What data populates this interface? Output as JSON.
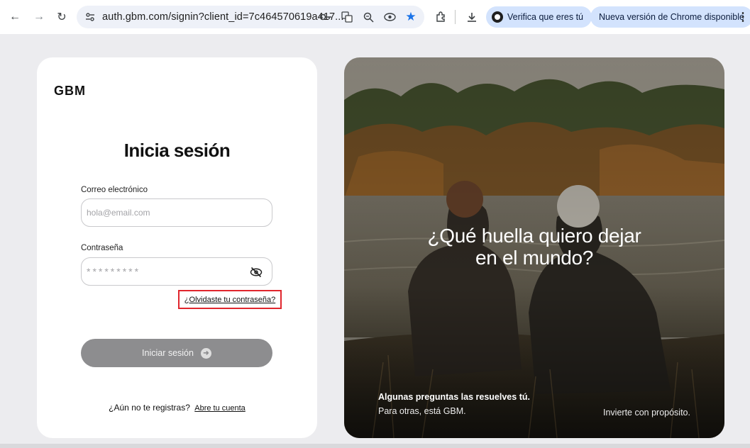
{
  "browser": {
    "url": "auth.gbm.com/signin?client_id=7c464570619a417...",
    "verify_chip": "Verifica que eres tú",
    "update_chip": "Nueva versión de Chrome disponible",
    "icons": [
      "back-icon",
      "forward-icon",
      "reload-icon",
      "tune-icon",
      "key-icon",
      "translate-icon",
      "zoom-icon",
      "eye-icon",
      "star-icon",
      "extensions-icon",
      "download-icon",
      "menu-icon"
    ]
  },
  "login": {
    "logo": "GBM",
    "title": "Inicia sesión",
    "email_label": "Correo electrónico",
    "email_placeholder": "hola@email.com",
    "password_label": "Contraseña",
    "password_mask": "*********",
    "forgot_link": "¿Olvidaste tu contraseña?",
    "submit_label": "Iniciar sesión",
    "register_prompt": "¿Aún no te registras?",
    "register_link": "Abre tu cuenta"
  },
  "hero": {
    "quote_line1": "¿Qué huella quiero dejar",
    "quote_line2": "en el mundo?",
    "tagline_bold": "Algunas preguntas las resuelves tú.",
    "tagline_sub": "Para otras, está GBM.",
    "tagline_right": "Invierte con propósito."
  },
  "colors": {
    "highlight_box": "#e0262d",
    "submit_button": "#8d8d8f",
    "chip": "#d3e3fd"
  }
}
